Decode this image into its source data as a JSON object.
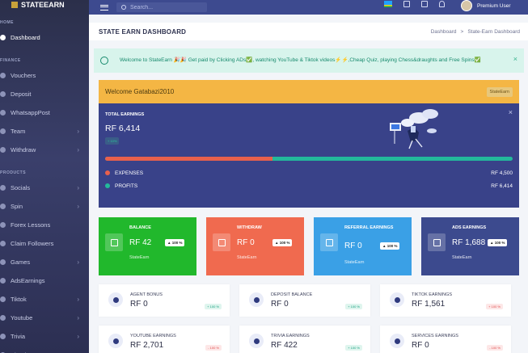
{
  "app": {
    "brand": "STATEEARN"
  },
  "sidebar": {
    "sections": [
      {
        "title": "HOME",
        "items": [
          {
            "label": "Dashboard",
            "icon": "dashboard-icon",
            "active": true,
            "chev": false
          }
        ]
      },
      {
        "title": "FINANCE",
        "items": [
          {
            "label": "Vouchers",
            "icon": "voucher-icon",
            "chev": false
          },
          {
            "label": "Deposit",
            "icon": "deposit-icon",
            "chev": false
          },
          {
            "label": "WhatsappPost",
            "icon": "whatsapp-icon",
            "chev": false
          },
          {
            "label": "Team",
            "icon": "team-icon",
            "chev": true
          },
          {
            "label": "Withdraw",
            "icon": "withdraw-icon",
            "chev": true
          }
        ]
      },
      {
        "title": "PRODUCTS",
        "items": [
          {
            "label": "Socials",
            "icon": "socials-icon",
            "chev": true
          },
          {
            "label": "Spin",
            "icon": "spin-icon",
            "chev": true
          },
          {
            "label": "Forex Lessons",
            "icon": "forex-icon",
            "chev": false
          },
          {
            "label": "Claim Followers",
            "icon": "followers-icon",
            "chev": false
          },
          {
            "label": "Games",
            "icon": "games-icon",
            "chev": true
          },
          {
            "label": "AdsEarnings",
            "icon": "ads-icon",
            "chev": false
          },
          {
            "label": "Tiktok",
            "icon": "tiktok-icon",
            "chev": true
          },
          {
            "label": "Youtube",
            "icon": "youtube-icon",
            "chev": true
          },
          {
            "label": "Trivia",
            "icon": "trivia-icon",
            "chev": true
          },
          {
            "label": "Ebooks",
            "icon": "ebooks-icon",
            "chev": false
          }
        ]
      }
    ]
  },
  "topbar": {
    "search_placeholder": "Search...",
    "user": "Premium User"
  },
  "page": {
    "title": "STATE EARN DASHBOARD",
    "breadcrumb": [
      "Dashboard",
      ">",
      "State-Earn Dashboard"
    ]
  },
  "alert": {
    "message": "Welcome to StateEarn 🎉🎉 Get paid by Clicking ADs✅, watching YouTube & Tiktok videos⚡⚡,Cheap Quiz, playing Chess&draughts and Free Spins✅"
  },
  "welcome": {
    "greeting": "Welcome Gatabazi2010",
    "tag": "StateEarn",
    "total_label": "TOTAL EARNINGS",
    "total_value": "RF 6,414",
    "total_pill": "+ 10%",
    "expenses_ratio": 0.41,
    "expenses_label": "EXPENSES",
    "expenses_value": "RF 4,500",
    "profits_label": "PROFITS",
    "profits_value": "RF 6,414"
  },
  "stat_cards": [
    {
      "title": "BALANCE",
      "value": "RF 42",
      "pct": "▲ 100 %",
      "sub": "StateEarn",
      "color": "#21b82c"
    },
    {
      "title": "WITHDRAW",
      "value": "RF 0",
      "pct": "▲ 100 %",
      "sub": "StateEarn",
      "color": "#f06a4f"
    },
    {
      "title": "REFERRAL EARNINGS",
      "value": "RF 0",
      "pct": "▲ 100 %",
      "sub": "StateEarn",
      "color": "#3aa0e6"
    },
    {
      "title": "ADS EARNINGS",
      "value": "RF 1,688",
      "pct": "▲ 100 %",
      "sub": "StateEarn",
      "color": "#3c4a8e"
    }
  ],
  "mini_cards": [
    {
      "title": "AGENT BONUS",
      "value": "RF 0",
      "pct": "+ 100 %",
      "trend": "up"
    },
    {
      "title": "DEPOSIT BALANCE",
      "value": "RF 0",
      "pct": "+ 100 %",
      "trend": "up"
    },
    {
      "title": "TIKTOK EARNINGS",
      "value": "RF 1,561",
      "pct": "+ 100 %",
      "trend": "down"
    },
    {
      "title": "YOUTUBE EARNINGS",
      "value": "RF 2,701",
      "pct": "- 100 %",
      "trend": "down"
    },
    {
      "title": "TRIVIA EARNINGS",
      "value": "RF 422",
      "pct": "+ 100 %",
      "trend": "up"
    },
    {
      "title": "SERVICES EARNINGS",
      "value": "RF 0",
      "pct": "- 100 %",
      "trend": "down"
    }
  ]
}
